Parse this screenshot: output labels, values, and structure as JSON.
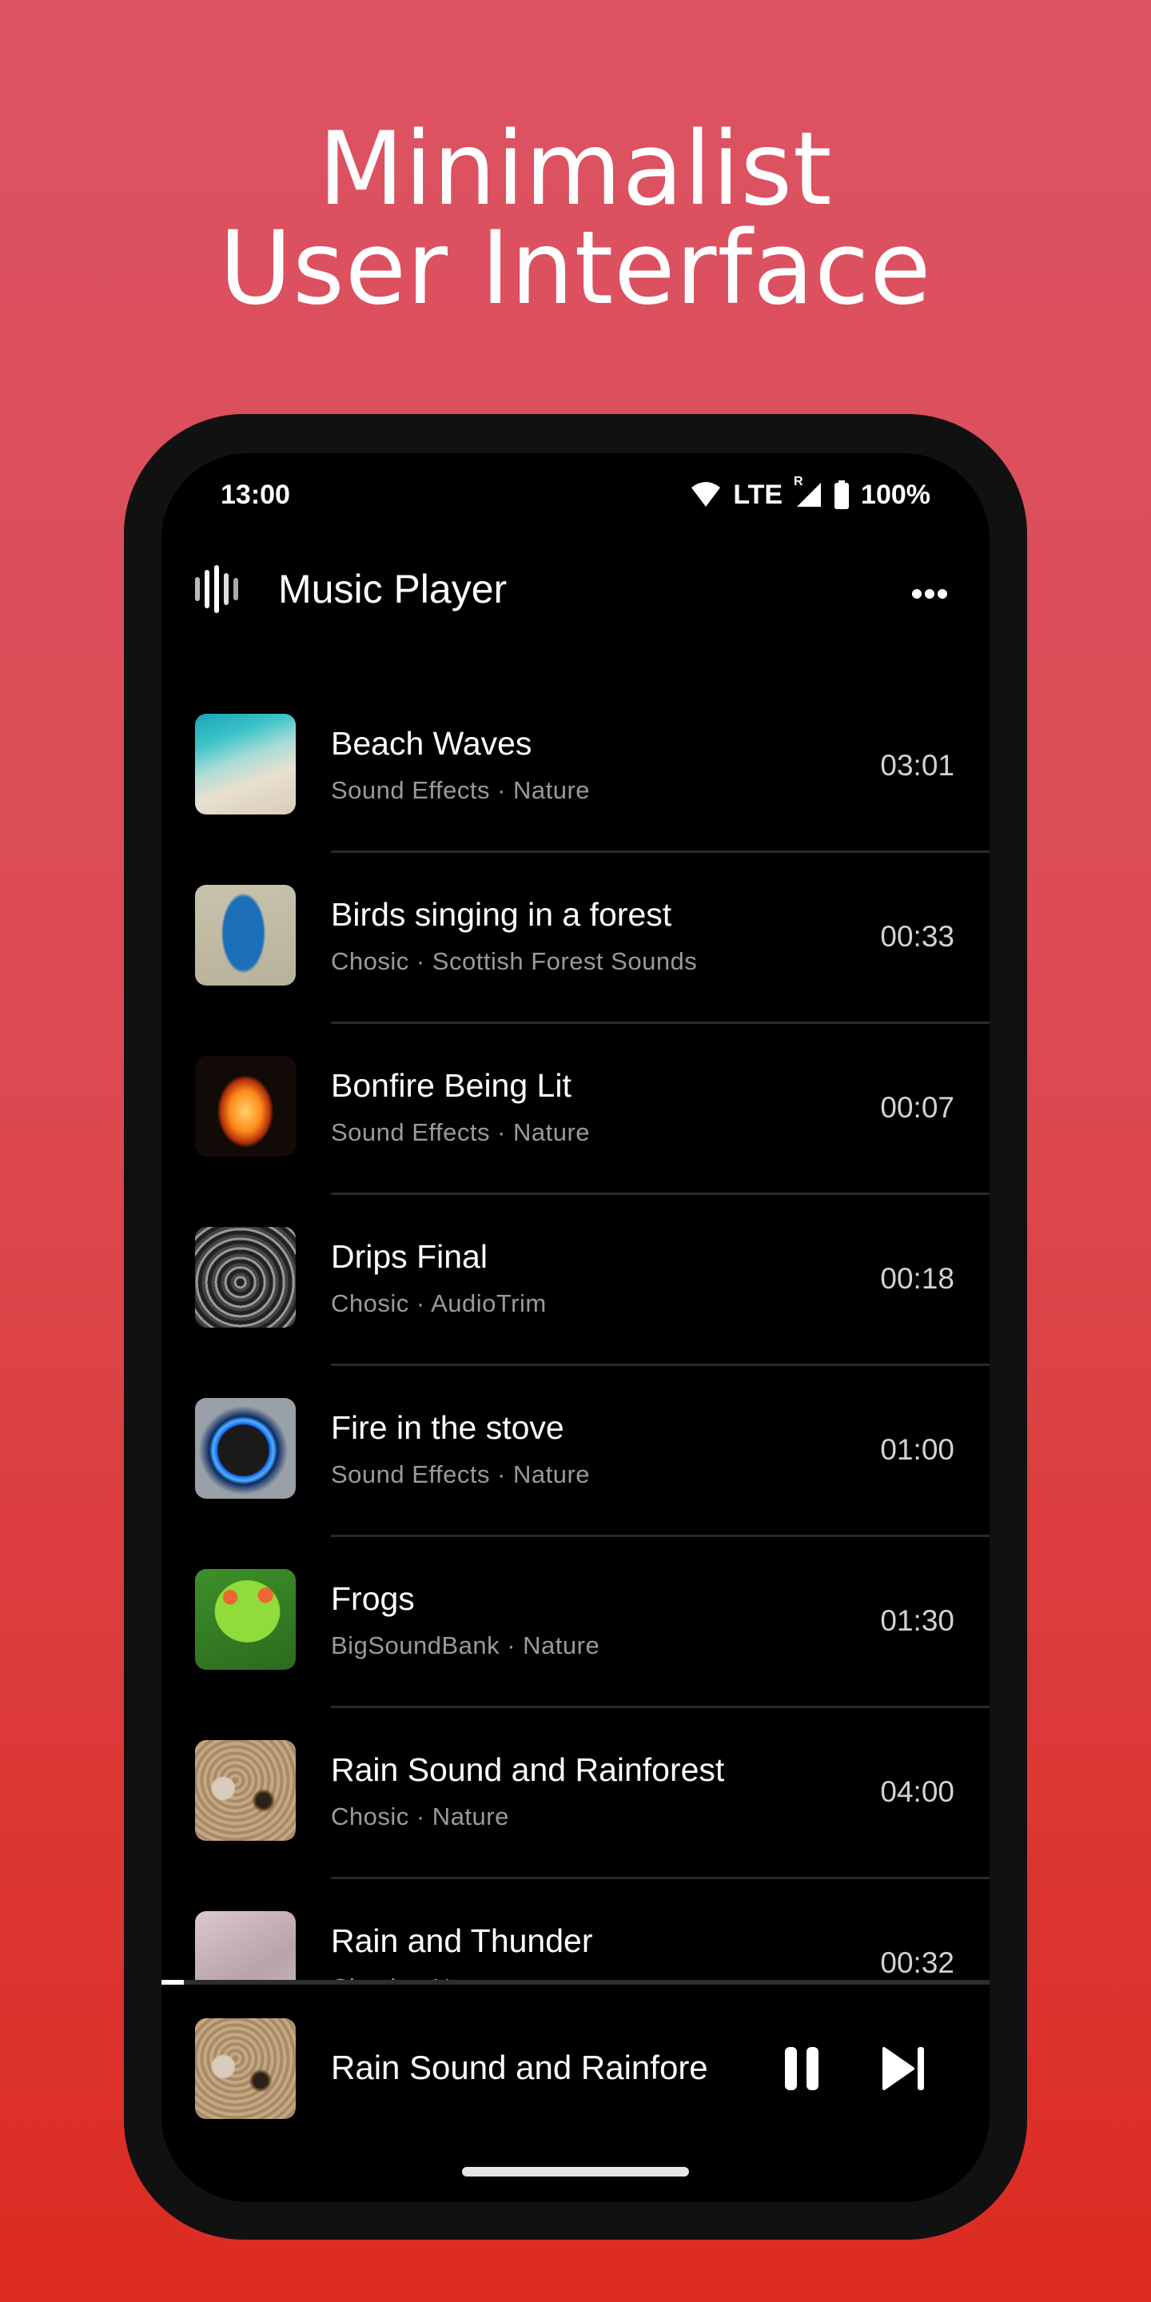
{
  "promo": {
    "line1": "Minimalist",
    "line2": "User Interface"
  },
  "status_bar": {
    "time": "13:00",
    "network": "LTE",
    "roaming": "R",
    "battery": "100%"
  },
  "app_bar": {
    "title": "Music Player",
    "logo_icon": "waveform-icon",
    "more_icon": "more-horizontal-icon"
  },
  "tracks": [
    {
      "title": "Beach Waves",
      "subtitle": "Sound Effects · Nature",
      "duration": "03:01",
      "art": "beach"
    },
    {
      "title": "Birds singing in a forest",
      "subtitle": "Chosic · Scottish Forest Sounds",
      "duration": "00:33",
      "art": "bird"
    },
    {
      "title": "Bonfire Being Lit",
      "subtitle": "Sound Effects · Nature",
      "duration": "00:07",
      "art": "fire"
    },
    {
      "title": "Drips Final",
      "subtitle": "Chosic · AudioTrim",
      "duration": "00:18",
      "art": "drips"
    },
    {
      "title": "Fire in the stove",
      "subtitle": "Sound Effects · Nature",
      "duration": "01:00",
      "art": "stove"
    },
    {
      "title": "Frogs",
      "subtitle": "BigSoundBank · Nature",
      "duration": "01:30",
      "art": "frog"
    },
    {
      "title": "Rain Sound and Rainforest",
      "subtitle": "Chosic · Nature",
      "duration": "04:00",
      "art": "leaf"
    },
    {
      "title": "Rain and Thunder",
      "subtitle": "Chosic · Nature",
      "duration": "00:32",
      "art": "thunder"
    }
  ],
  "now_playing": {
    "title": "Rain Sound and Rainfore",
    "progress_fraction": 0.027,
    "pause_icon": "pause-icon",
    "next_icon": "skip-next-icon"
  },
  "colors": {
    "bg_top": "#dc5364",
    "bg_bottom": "#dc2b22",
    "screen": "#000000",
    "frame": "#111111",
    "subtitle": "#9a9a9a"
  }
}
